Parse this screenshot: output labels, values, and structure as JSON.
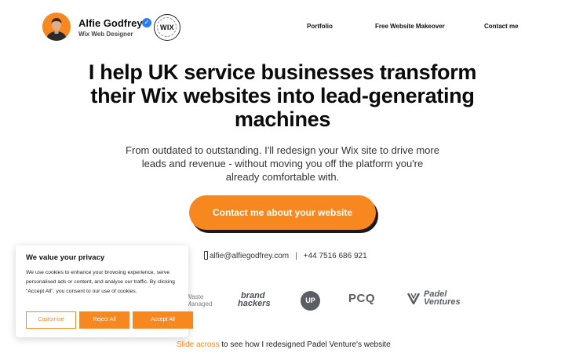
{
  "header": {
    "name": "Alfie Godfrey",
    "role": "Wix Web Designer",
    "badge_text": "WIX",
    "nav": [
      {
        "label": "Portfolio"
      },
      {
        "label": "Free Website Makeover"
      },
      {
        "label": "Contact me"
      }
    ]
  },
  "hero": {
    "title": "I help UK service businesses transform their Wix websites into lead-generating machines",
    "subtitle": "From outdated to outstanding. I'll redesign your Wix site to drive more leads and revenue - without moving you off the platform you're already comfortable with.",
    "cta_label": "Contact me about your website"
  },
  "contact": {
    "email": "alfie@alfiegodfrey.com",
    "separator": "|",
    "phone": "+44 7516 686 921"
  },
  "logos": {
    "waste_line1": "Waste",
    "waste_line2": "Managed",
    "brand_line1": "brand",
    "brand_line2": "hackers",
    "up": "UP",
    "pcq": "PCQ",
    "padel_line1": "Padel",
    "padel_line2": "Ventures"
  },
  "slide": {
    "accent": "Slide across",
    "rest": " to see how I redesigned Padel Venture's website"
  },
  "cookie": {
    "title": "We value your privacy",
    "text": "We use cookies to enhance your browsing experience, serve personalised ads or content, and analyse our traffic. By clicking \"Accept All\", you consent to our use of cookies.",
    "customise_label": "Customise",
    "reject_label": "Reject All",
    "accept_label": "Accept All"
  },
  "colors": {
    "accent": "#f7881f",
    "verified": "#2b7bf6",
    "logo_gray": "#5a5f66"
  }
}
